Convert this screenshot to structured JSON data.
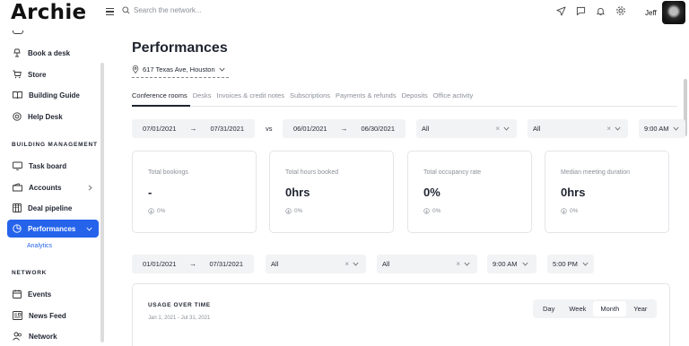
{
  "app": {
    "logo": "Archie"
  },
  "header": {
    "search_placeholder": "Search the network...",
    "user_name": "Jeff"
  },
  "sidebar": {
    "items_top": [
      {
        "label": "Book a desk",
        "icon": "desk-lamp-icon"
      },
      {
        "label": "Store",
        "icon": "cart-icon"
      },
      {
        "label": "Building Guide",
        "icon": "book-icon"
      },
      {
        "label": "Help Desk",
        "icon": "lifebuoy-icon"
      }
    ],
    "section_building": "BUILDING MANAGEMENT",
    "items_building": [
      {
        "label": "Task board",
        "icon": "monitor-icon"
      },
      {
        "label": "Accounts",
        "icon": "wallet-icon"
      },
      {
        "label": "Deal pipeline",
        "icon": "kanban-icon"
      },
      {
        "label": "Performances",
        "icon": "clock-chart-icon",
        "active": true
      }
    ],
    "sub_item": "Analytics",
    "section_network": "NETWORK",
    "items_network": [
      {
        "label": "Events",
        "icon": "calendar-icon"
      },
      {
        "label": "News Feed",
        "icon": "newspaper-icon"
      },
      {
        "label": "Network",
        "icon": "people-icon"
      }
    ]
  },
  "main": {
    "title": "Performances",
    "location": "617 Texas Ave, Houston",
    "tabs": [
      {
        "label": "Conference rooms",
        "active": true
      },
      {
        "label": "Desks"
      },
      {
        "label": "Invoices & credit notes"
      },
      {
        "label": "Subscriptions"
      },
      {
        "label": "Payments & refunds"
      },
      {
        "label": "Deposits"
      },
      {
        "label": "Office activity"
      }
    ],
    "filters1": {
      "range_a": {
        "start": "07/01/2021",
        "end": "07/31/2021"
      },
      "vs": "vs",
      "range_b": {
        "start": "06/01/2021",
        "end": "06/30/2021"
      },
      "select_1": "All",
      "select_2": "All",
      "time": "9:00 AM"
    },
    "cards": [
      {
        "label": "Total bookings",
        "value": "-",
        "delta": "0%"
      },
      {
        "label": "Total hours booked",
        "value": "0hrs",
        "delta": "0%"
      },
      {
        "label": "Total occupancy rate",
        "value": "0%",
        "delta": "0%"
      },
      {
        "label": "Median meeting duration",
        "value": "0hrs",
        "delta": "0%"
      }
    ],
    "filters2": {
      "range": {
        "start": "01/01/2021",
        "end": "07/31/2021"
      },
      "select_1": "All",
      "select_2": "All",
      "time_start": "9:00 AM",
      "time_end": "5:00 PM"
    },
    "usage": {
      "title": "USAGE OVER TIME",
      "subtitle": "Jan 1, 2021 - Jul 31, 2021",
      "periods": [
        {
          "label": "Day"
        },
        {
          "label": "Week"
        },
        {
          "label": "Month",
          "active": true
        },
        {
          "label": "Year"
        }
      ]
    }
  },
  "colors": {
    "accent": "#2563eb",
    "text": "#1f2430",
    "muted": "#8a8f98",
    "field_bg": "#f2f3f5"
  }
}
